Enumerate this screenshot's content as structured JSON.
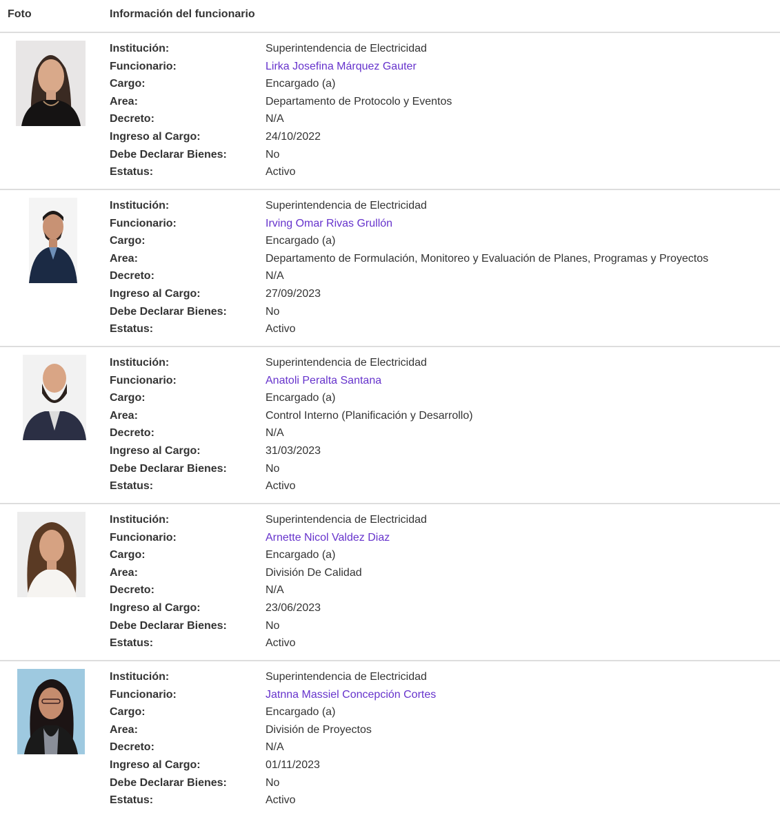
{
  "headers": {
    "foto": "Foto",
    "info": "Información del funcionario"
  },
  "labels": {
    "institucion": "Institución:",
    "funcionario": "Funcionario:",
    "cargo": "Cargo:",
    "area": "Area:",
    "decreto": "Decreto:",
    "ingreso": "Ingreso al Cargo:",
    "declarar": "Debe Declarar Bienes:",
    "estatus": "Estatus:"
  },
  "colors": {
    "link": "#6633cc",
    "text": "#333333",
    "border": "#dddddd"
  },
  "officials": [
    {
      "institucion": "Superintendencia de Electricidad",
      "funcionario": "Lirka Josefina Márquez Gauter",
      "cargo": "Encargado (a)",
      "area": "Departamento de Protocolo y Eventos",
      "decreto": "N/A",
      "ingreso": "24/10/2022",
      "declarar": "No",
      "estatus": "Activo"
    },
    {
      "institucion": "Superintendencia de Electricidad",
      "funcionario": "Irving Omar Rivas Grullón",
      "cargo": "Encargado (a)",
      "area": "Departamento de Formulación, Monitoreo y Evaluación de Planes, Programas y Proyectos",
      "decreto": "N/A",
      "ingreso": "27/09/2023",
      "declarar": "No",
      "estatus": "Activo"
    },
    {
      "institucion": "Superintendencia de Electricidad",
      "funcionario": "Anatoli Peralta Santana",
      "cargo": "Encargado (a)",
      "area": "Control Interno (Planificación y Desarrollo)",
      "decreto": "N/A",
      "ingreso": "31/03/2023",
      "declarar": "No",
      "estatus": "Activo"
    },
    {
      "institucion": "Superintendencia de Electricidad",
      "funcionario": "Arnette Nicol Valdez Diaz",
      "cargo": "Encargado (a)",
      "area": "División De Calidad",
      "decreto": "N/A",
      "ingreso": "23/06/2023",
      "declarar": "No",
      "estatus": "Activo"
    },
    {
      "institucion": "Superintendencia de Electricidad",
      "funcionario": "Jatnna Massiel Concepción Cortes",
      "cargo": "Encargado (a)",
      "area": "División de Proyectos",
      "decreto": "N/A",
      "ingreso": "01/11/2023",
      "declarar": "No",
      "estatus": "Activo"
    }
  ]
}
